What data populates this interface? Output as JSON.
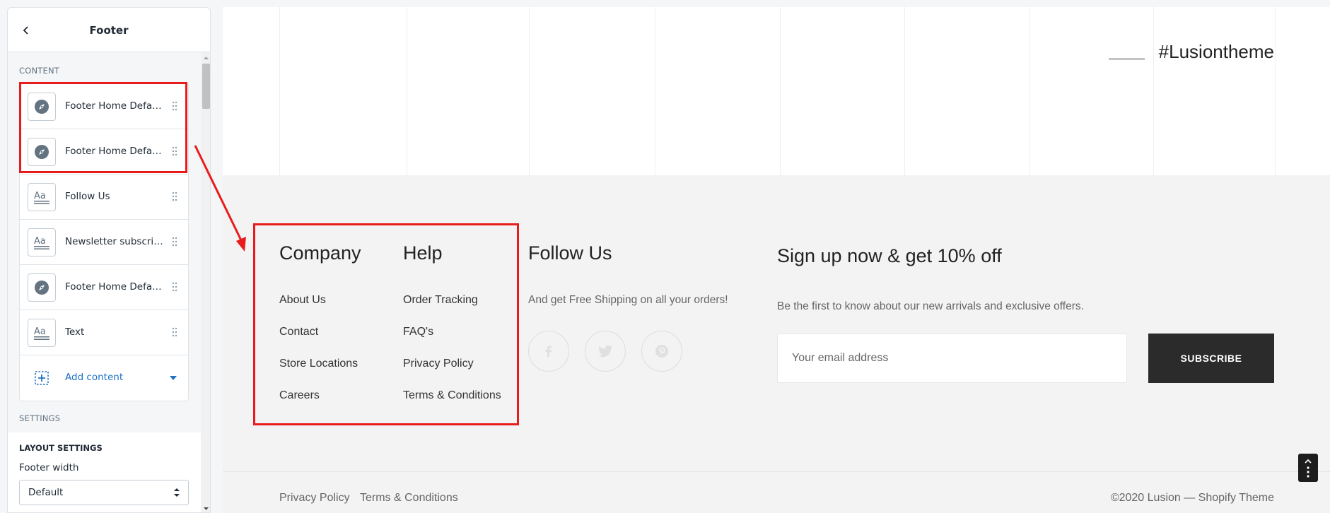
{
  "sidebar": {
    "title": "Footer",
    "content_label": "CONTENT",
    "blocks": [
      {
        "label": "Footer Home Default Column",
        "icon": "compass-icon"
      },
      {
        "label": "Footer Home Default Column",
        "icon": "compass-icon"
      },
      {
        "label": "Follow Us",
        "icon": "text-icon"
      },
      {
        "label": "Newsletter subscribe",
        "icon": "text-icon"
      },
      {
        "label": "Footer Home Default Column",
        "icon": "compass-icon"
      },
      {
        "label": "Text",
        "icon": "text-icon"
      }
    ],
    "add_content_label": "Add content",
    "settings_label": "SETTINGS",
    "layout_settings_label": "LAYOUT SETTINGS",
    "footer_width_label": "Footer width",
    "footer_width_value": "Default"
  },
  "preview": {
    "instagram_tag": "#Lusiontheme",
    "columns": [
      {
        "heading": "Company",
        "links": [
          "About Us",
          "Contact",
          "Store Locations",
          "Careers"
        ]
      },
      {
        "heading": "Help",
        "links": [
          "Order Tracking",
          "FAQ's",
          "Privacy Policy",
          "Terms & Conditions"
        ]
      }
    ],
    "follow": {
      "heading": "Follow Us",
      "text": "And get Free Shipping on all your orders!",
      "icons": [
        "facebook-icon",
        "twitter-icon",
        "pinterest-icon"
      ]
    },
    "newsletter": {
      "heading": "Sign up now & get 10% off",
      "text": "Be the first to know about our new arrivals and exclusive offers.",
      "placeholder": "Your email address",
      "button": "SUBSCRIBE"
    },
    "bottom": {
      "links": [
        "Privacy Policy",
        "Terms & Conditions"
      ],
      "copyright": "©2020 Lusion — Shopify Theme"
    }
  },
  "colors": {
    "annotation": "#e81c1c",
    "link_blue": "#1d72c6",
    "button_dark": "#2b2b2b",
    "footer_bg": "#f3f3f3"
  }
}
